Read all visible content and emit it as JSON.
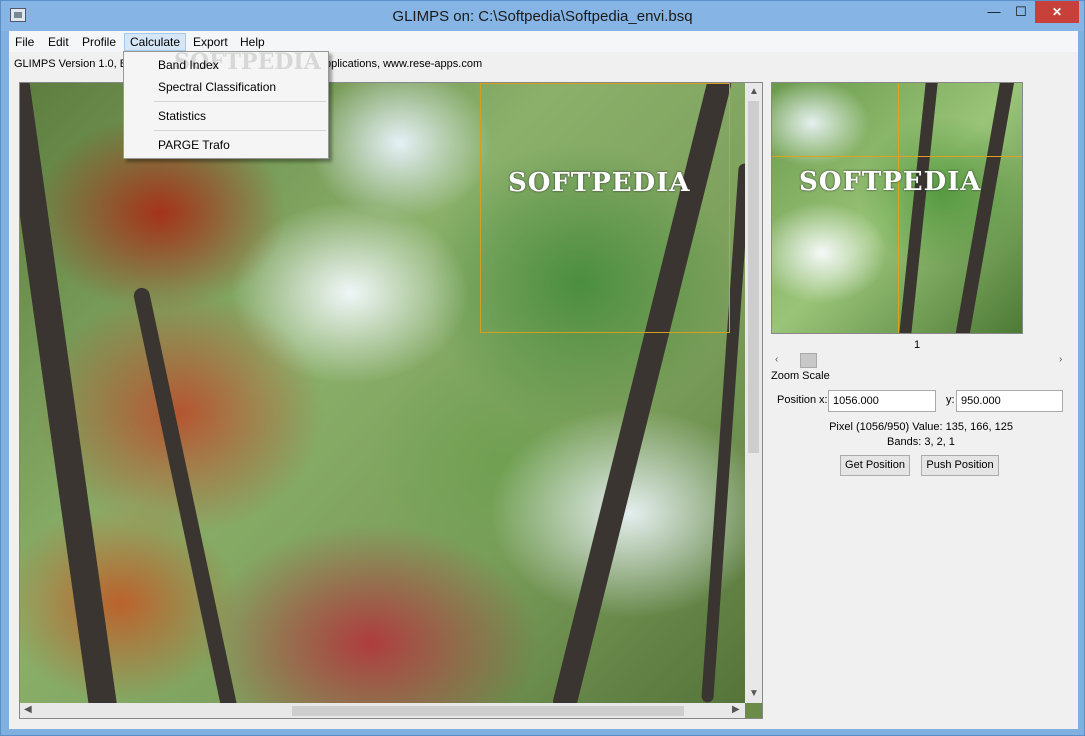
{
  "window": {
    "title": "GLIMPS on: C:\\Softpedia\\Softpedia_envi.bsq",
    "controls": {
      "minimize": "—",
      "maximize": "☐",
      "close": "✕"
    }
  },
  "menu": {
    "items": [
      "File",
      "Edit",
      "Profile",
      "Calculate",
      "Export",
      "Help"
    ],
    "active": "Calculate"
  },
  "calculate_menu": {
    "items": [
      "Band Index",
      "Spectral Classification",
      "Statistics",
      "PARGE Trafo"
    ],
    "watermark": "SOFTPEDIA"
  },
  "info": {
    "version_text": "GLIMPS Version 1.0, B",
    "url_text": "pplications, www.rese-apps.com"
  },
  "image_view": {
    "watermark": "SOFTPEDIA"
  },
  "preview": {
    "watermark": "SOFTPEDIA",
    "zoom_value": "1",
    "zoom_label": "Zoom Scale"
  },
  "position": {
    "label": "Position",
    "x_label": "x:",
    "x_value": "1056.000",
    "y_label": "y:",
    "y_value": "950.000"
  },
  "pixel_info": {
    "value_line": "Pixel (1056/950) Value: 135, 166, 125",
    "bands_line": "Bands:  3,  2,  1"
  },
  "buttons": {
    "get_position": "Get Position",
    "push_position": "Push Position"
  },
  "colors": {
    "titlebar": "#86b4e4",
    "close_button": "#c7403a",
    "crosshair": "#e0a020"
  }
}
